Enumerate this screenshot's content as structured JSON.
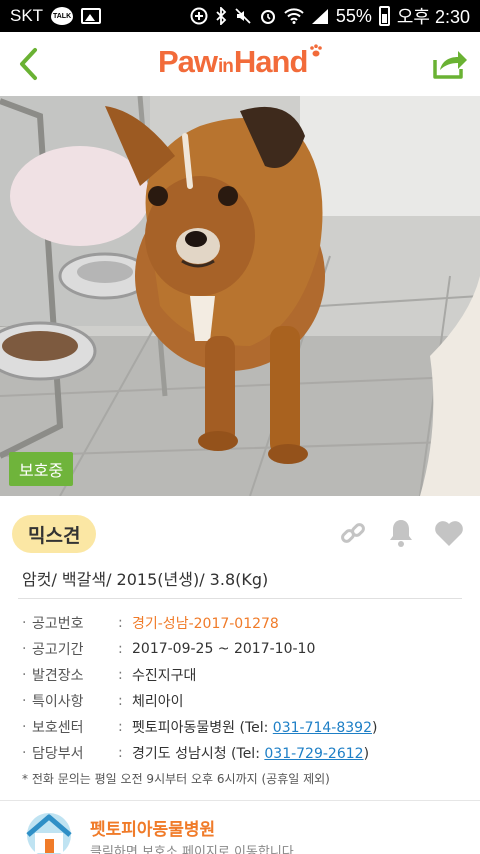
{
  "status_bar": {
    "carrier": "SKT",
    "talk_badge": "TALK",
    "battery": "55%",
    "time": "오후 2:30"
  },
  "header": {
    "logo_part1": "Paw",
    "logo_part2": "in",
    "logo_part3": "Hand",
    "accent_color": "#f26b3a",
    "back_icon": "chevron-left-icon",
    "share_icon": "share-icon"
  },
  "photo": {
    "status_tag": "보호중"
  },
  "animal": {
    "breed": "믹스견",
    "summary": "암컷/ 백갈색/ 2015(년생)/ 3.8(Kg)"
  },
  "details": [
    {
      "key": "공고번호",
      "value": "경기-성남-2017-01278"
    },
    {
      "key": "공고기간",
      "value": "2017-09-25 ~ 2017-10-10"
    },
    {
      "key": "발견장소",
      "value": "수진지구대"
    },
    {
      "key": "특이사항",
      "value": "체리아이"
    },
    {
      "key": "보호센터",
      "value": "펫토피아동물병원 (Tel: ",
      "phone": "031-714-8392",
      "tail": ")"
    },
    {
      "key": "담당부서",
      "value": "경기도 성남시청 (Tel: ",
      "phone": "031-729-2612",
      "tail": ")"
    }
  ],
  "note": "* 전화 문의는 평일 오전 9시부터 오후 6시까지 (공휴일 제외)",
  "shelter_card": {
    "name": "펫토피아동물병원",
    "subtitle": "클릭하면 보호소 페이지로 이동합니다"
  }
}
